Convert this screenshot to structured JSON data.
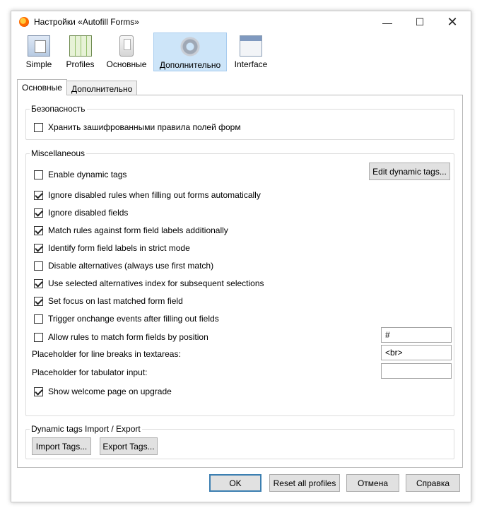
{
  "window": {
    "title": "Настройки «Autofill Forms»",
    "minimize": "—",
    "maximize": "☐",
    "close": "✕"
  },
  "toolbar": {
    "items": [
      {
        "label": "Simple"
      },
      {
        "label": "Profiles"
      },
      {
        "label": "Основные"
      },
      {
        "label": "Дополнительно"
      },
      {
        "label": "Interface"
      }
    ]
  },
  "tabs": [
    {
      "label": "Основные"
    },
    {
      "label": "Дополнительно"
    }
  ],
  "security": {
    "title": "Безопасность",
    "encrypt_label": "Хранить зашифрованными правила полей форм",
    "encrypt_checked": false
  },
  "misc": {
    "title": "Miscellaneous",
    "edit_dynamic_tags": "Edit dynamic tags...",
    "options": [
      {
        "label": "Enable dynamic tags",
        "checked": false
      },
      {
        "label": "Ignore disabled rules when filling out forms automatically",
        "checked": true
      },
      {
        "label": "Ignore disabled fields",
        "checked": true
      },
      {
        "label": "Match rules against form field labels additionally",
        "checked": true
      },
      {
        "label": "Identify form field labels in strict mode",
        "checked": true
      },
      {
        "label": "Disable alternatives (always use first match)",
        "checked": false
      },
      {
        "label": "Use selected alternatives index for subsequent selections",
        "checked": true
      },
      {
        "label": "Set focus on last matched form field",
        "checked": true
      },
      {
        "label": "Trigger onchange events after filling out fields",
        "checked": false
      },
      {
        "label": "Allow rules to match form fields by position",
        "checked": false
      }
    ],
    "position_marker_value": "#",
    "line_breaks_label": "Placeholder for line breaks in textareas:",
    "line_breaks_value": "<br>",
    "tabulator_label": "Placeholder for tabulator input:",
    "tabulator_value": "",
    "welcome_label": "Show welcome page on upgrade",
    "welcome_checked": true
  },
  "dyn_tags": {
    "title": "Dynamic tags Import / Export",
    "import": "Import Tags...",
    "export": "Export Tags..."
  },
  "footer": {
    "ok": "OK",
    "reset": "Reset all profiles",
    "cancel": "Отмена",
    "help": "Справка"
  }
}
